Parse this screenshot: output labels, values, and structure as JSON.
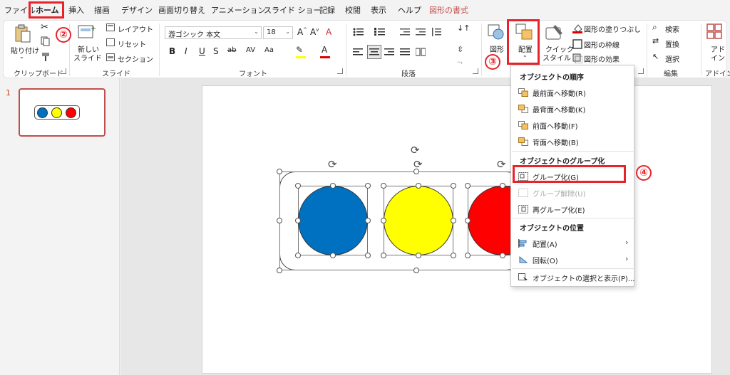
{
  "tabs": [
    "ファイル",
    "ホーム",
    "挿入",
    "描画",
    "デザイン",
    "画面切り替え",
    "アニメーション",
    "スライド ショー",
    "記録",
    "校閲",
    "表示",
    "ヘルプ",
    "図形の書式"
  ],
  "ribbon": {
    "clipboard": {
      "paste": "貼り付け",
      "label": "クリップボード"
    },
    "slides": {
      "new_slide_1": "新しい",
      "new_slide_2": "スライド",
      "layout": "レイアウト",
      "reset": "リセット",
      "section": "セクション",
      "label": "スライド"
    },
    "font": {
      "name": "游ゴシック 本文",
      "size": "18",
      "label": "フォント"
    },
    "paragraph": {
      "label": "段落"
    },
    "drawing": {
      "shapes": "図形",
      "arrange": "配置",
      "quick_1": "クイック",
      "quick_2": "スタイル",
      "fill": "図形の塗りつぶし",
      "outline": "図形の枠線",
      "effects": "図形の効果"
    },
    "editing": {
      "find": "検索",
      "replace": "置換",
      "select": "選択",
      "label": "編集"
    },
    "addins": {
      "addin_1": "アド",
      "addin_2": "イン",
      "label": "アドイン"
    }
  },
  "callouts": [
    "②",
    "③",
    "④"
  ],
  "thumbnail": {
    "number": "1"
  },
  "menu": {
    "order_header": "オブジェクトの順序",
    "bring_front": "最前面へ移動(R)",
    "send_back": "最背面へ移動(K)",
    "bring_forward": "前面へ移動(F)",
    "send_backward": "背面へ移動(B)",
    "group_header": "オブジェクトのグループ化",
    "group": "グループ化(G)",
    "ungroup": "グループ解除(U)",
    "regroup": "再グループ化(E)",
    "position_header": "オブジェクトの位置",
    "align": "配置(A)",
    "rotate": "回転(O)",
    "selection_pane": "オブジェクトの選択と表示(P)..."
  },
  "colors": {
    "blue": "#0070c0",
    "yellow": "#ffff00",
    "red": "#ff0000",
    "accent": "#b7472a",
    "callout": "#e8242a"
  }
}
